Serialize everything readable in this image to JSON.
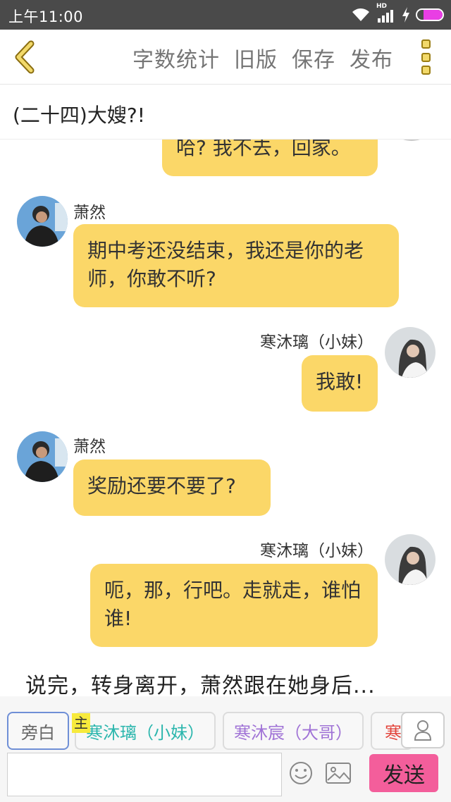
{
  "status_bar": {
    "time": "上午11:00",
    "network_label": "HD",
    "icons": [
      "wifi-icon",
      "signal-icon",
      "charge-icon",
      "battery-icon"
    ],
    "battery_color": "#e93ee4"
  },
  "toolbar": {
    "back_icon": "chevron-left-icon",
    "actions": [
      "字数统计",
      "旧版",
      "保存",
      "发布"
    ],
    "more_icon": "more-vertical-icon"
  },
  "chapter": {
    "title": "(二十四)大嫂?!"
  },
  "messages": [
    {
      "side": "right",
      "text": "哈? 我不去，回家。",
      "partial": true
    },
    {
      "side": "left",
      "speaker": "萧然",
      "avatar": "avatar-male",
      "text": "期中考还没结束，我还是你的老师，你敢不听?"
    },
    {
      "side": "right",
      "speaker": "寒沐璃（小妹）",
      "avatar": "avatar-female",
      "text": "我敢!"
    },
    {
      "side": "left",
      "speaker": "萧然",
      "avatar": "avatar-male",
      "text": "奖励还要不要了?"
    },
    {
      "side": "right",
      "speaker": "寒沐璃（小妹）",
      "avatar": "avatar-female",
      "text": "呃，那，行吧。走就走，谁怕谁!"
    }
  ],
  "narration": "说完，转身离开，萧然跟在她身后...",
  "characters": {
    "narration_label": "旁白",
    "main_tag": "主",
    "items": [
      {
        "label": "寒沐璃（小妹）",
        "color": "#2bb6ad"
      },
      {
        "label": "寒沐宸（大哥）",
        "color": "#a073d6"
      },
      {
        "label": "寒",
        "color": "#e2453c"
      }
    ],
    "profile_icon": "user-icon"
  },
  "input_bar": {
    "value": "",
    "emoji_icon": "emoji-icon",
    "image_icon": "image-icon",
    "send_label": "发送",
    "bubble_color": "#fbd768",
    "send_color": "#f35e9b"
  }
}
